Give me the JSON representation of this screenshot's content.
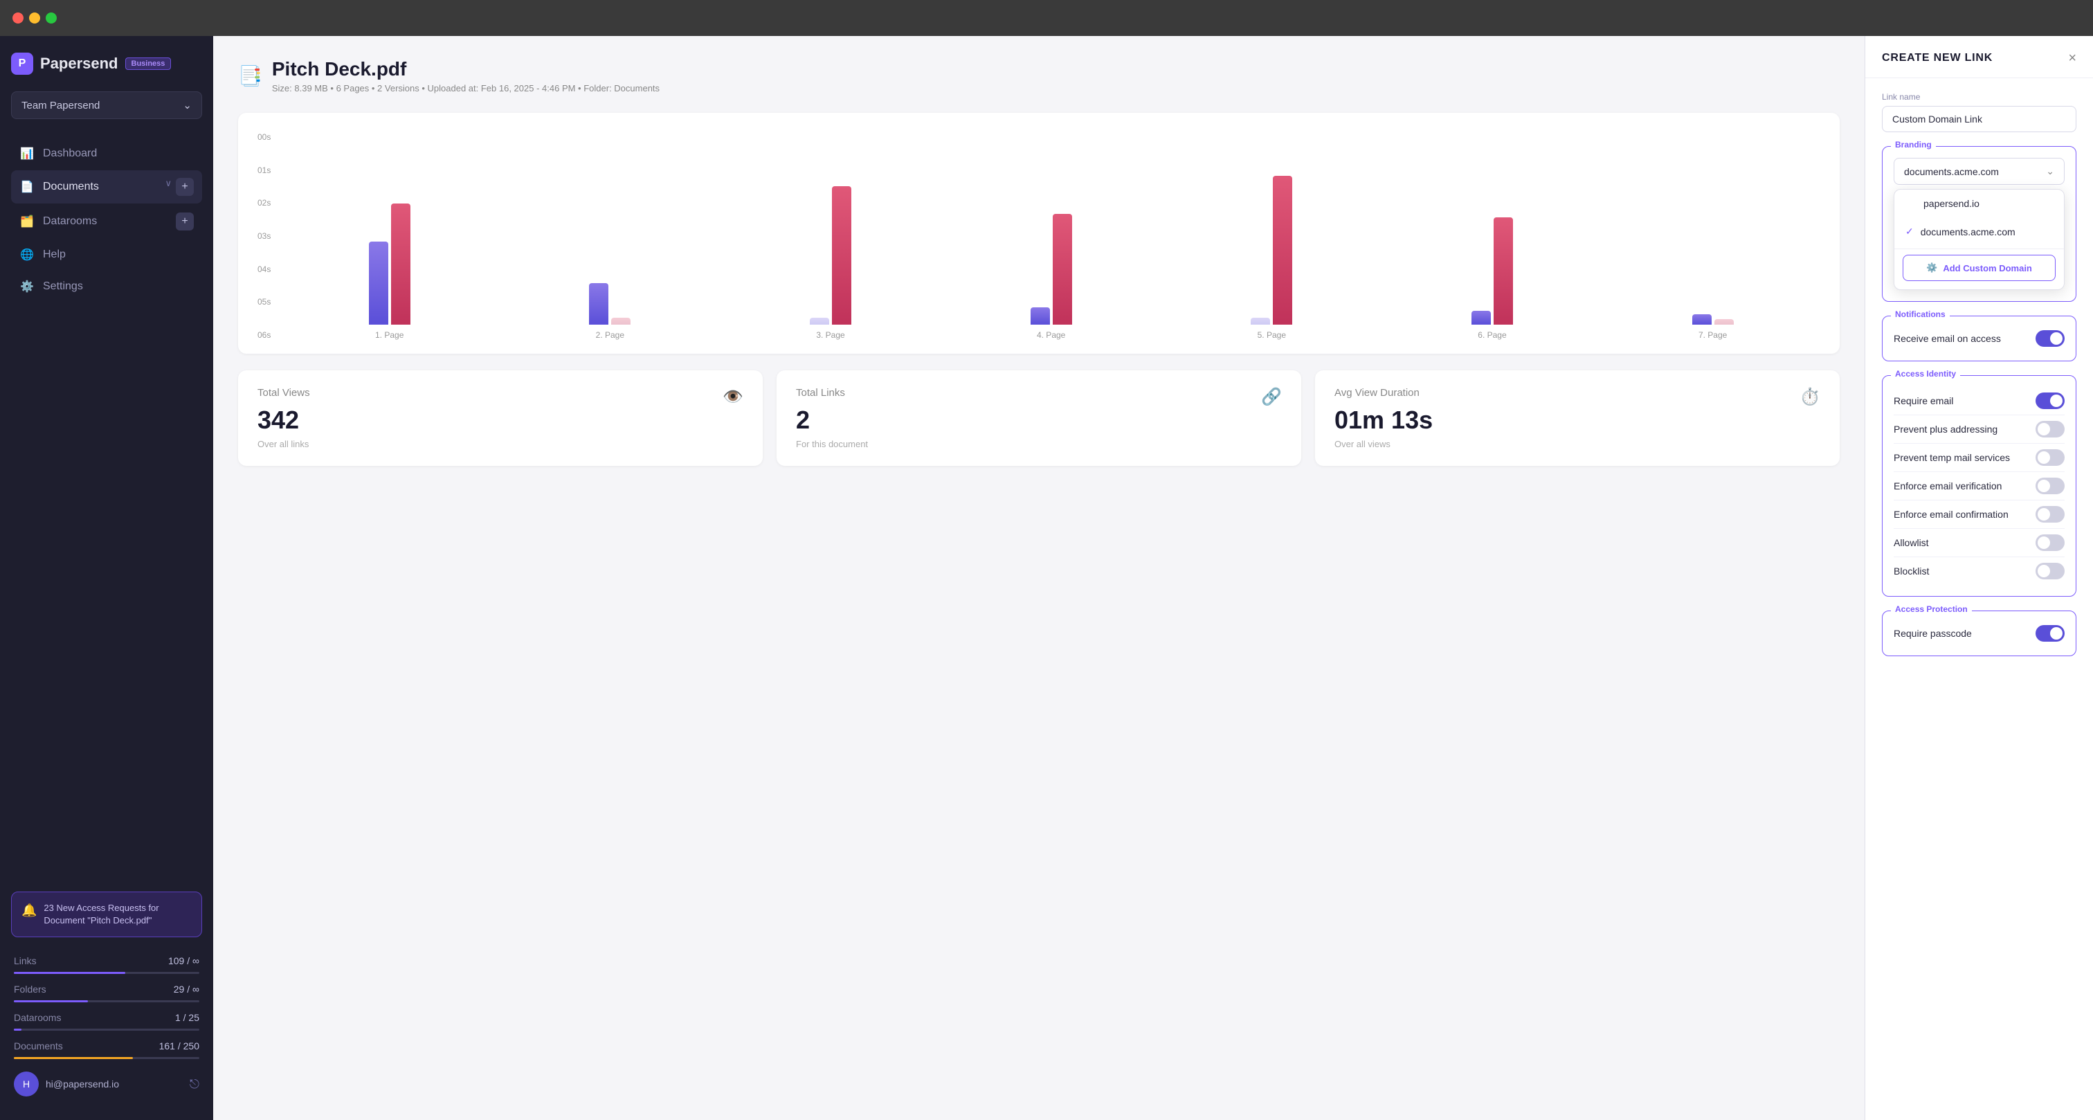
{
  "titlebar": {
    "buttons": [
      "close",
      "minimize",
      "maximize"
    ]
  },
  "sidebar": {
    "logo": {
      "icon": "P",
      "text": "Papersend",
      "badge": "Business"
    },
    "team": {
      "name": "Team Papersend"
    },
    "nav_items": [
      {
        "id": "dashboard",
        "label": "Dashboard",
        "icon": "📊",
        "active": false
      },
      {
        "id": "documents",
        "label": "Documents",
        "icon": "📄",
        "active": true,
        "has_chevron": true,
        "has_add": true
      },
      {
        "id": "datarooms",
        "label": "Datarooms",
        "icon": "🗂️",
        "active": false,
        "has_add": true
      },
      {
        "id": "help",
        "label": "Help",
        "icon": "🌐",
        "active": false
      },
      {
        "id": "settings",
        "label": "Settings",
        "icon": "⚙️",
        "active": false
      }
    ],
    "notification": {
      "text": "23 New Access Requests for Document \"Pitch Deck.pdf\""
    },
    "stats": [
      {
        "label": "Links",
        "value": "109 / ∞",
        "bar_color": "#7c5cfc",
        "bar_pct": 60
      },
      {
        "label": "Folders",
        "value": "29 / ∞",
        "bar_color": "#7c5cfc",
        "bar_pct": 40
      },
      {
        "label": "Datarooms",
        "value": "1 / 25",
        "bar_color": "#7c5cfc",
        "bar_pct": 4
      },
      {
        "label": "Documents",
        "value": "161 / 250",
        "bar_color": "#f5a623",
        "bar_pct": 64
      }
    ],
    "user": {
      "email": "hi@papersend.io",
      "avatar": "hi"
    }
  },
  "main": {
    "doc": {
      "title": "Pitch Deck.pdf",
      "meta": "Size: 8.39 MB • 6 Pages • 2 Versions • Uploaded at: Feb 16, 2025 - 4:46 PM • Folder: Documents"
    },
    "chart": {
      "y_labels": [
        "06s",
        "05s",
        "04s",
        "03s",
        "02s",
        "01s",
        "00s"
      ],
      "pages": [
        {
          "label": "1. Page",
          "purple_h": 120,
          "red_h": 175
        },
        {
          "label": "2. Page",
          "purple_h": 60,
          "red_h": 0
        },
        {
          "label": "3. Page",
          "purple_h": 0,
          "red_h": 200
        },
        {
          "label": "4. Page",
          "purple_h": 25,
          "red_h": 160
        },
        {
          "label": "5. Page",
          "purple_h": 0,
          "red_h": 215
        },
        {
          "label": "6. Page",
          "purple_h": 20,
          "red_h": 155
        },
        {
          "label": "7. Page",
          "purple_h": 15,
          "red_h": 0
        }
      ]
    },
    "stats_cards": [
      {
        "label": "Total Views",
        "value": "342",
        "sub": "Over all links",
        "icon": "👁️"
      },
      {
        "label": "Total Links",
        "value": "2",
        "sub": "For this document",
        "icon": "🔗"
      },
      {
        "label": "Avg View Duration",
        "value": "01m 13s",
        "sub": "Over all views",
        "icon": "⏱️"
      }
    ]
  },
  "panel": {
    "title": "CREATE NEW LINK",
    "close_label": "×",
    "link_name_label": "Link name",
    "link_name_value": "Custom Domain Link",
    "branding_label": "Branding",
    "branding_selected": "documents.acme.com",
    "branding_options": [
      {
        "label": "papersend.io",
        "selected": false
      },
      {
        "label": "documents.acme.com",
        "selected": true
      }
    ],
    "add_domain_label": "Add Custom Domain",
    "add_domain_icon": "⚙️",
    "notifications_label": "Notifications",
    "receive_email_label": "Receive email on access",
    "receive_email_on": true,
    "access_identity_label": "Access Identity",
    "access_identity_items": [
      {
        "label": "Require email",
        "on": true
      },
      {
        "label": "Prevent plus addressing",
        "on": false
      },
      {
        "label": "Prevent temp mail services",
        "on": false
      },
      {
        "label": "Enforce email verification",
        "on": false
      },
      {
        "label": "Enforce email confirmation",
        "on": false
      },
      {
        "label": "Allowlist",
        "on": false
      },
      {
        "label": "Blocklist",
        "on": false
      }
    ],
    "access_protection_label": "Access Protection",
    "require_passcode_label": "Require passcode",
    "require_passcode_on": true
  }
}
